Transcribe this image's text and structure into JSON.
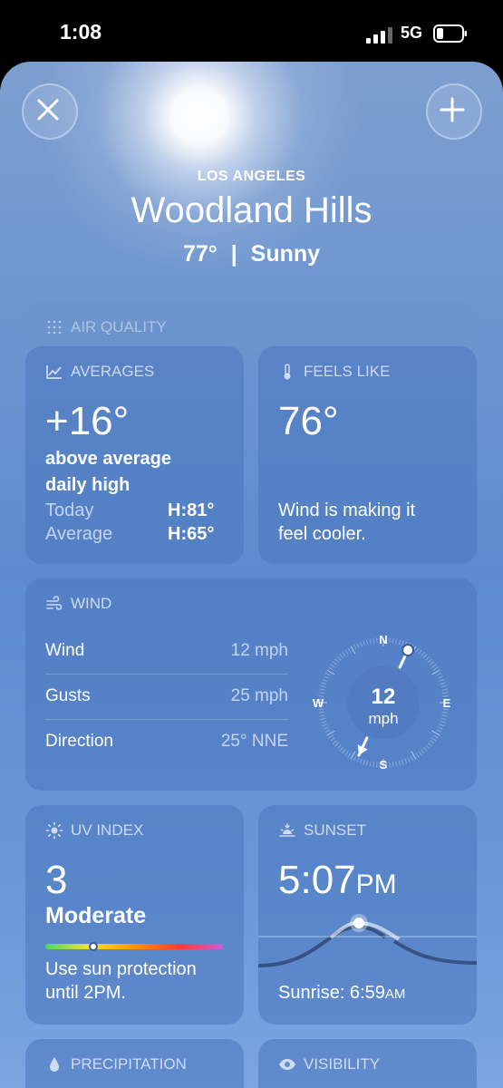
{
  "status": {
    "time": "1:08",
    "network": "5G"
  },
  "header": {
    "city": "LOS ANGELES",
    "place": "Woodland Hills",
    "temp": "77°",
    "separator": "|",
    "condition": "Sunny"
  },
  "icons": {
    "close": "close-icon",
    "add": "plus-icon"
  },
  "air_quality": {
    "title": "AIR QUALITY"
  },
  "averages": {
    "title": "AVERAGES",
    "value": "+16°",
    "line1": "above average",
    "line2": "daily high",
    "today_label": "Today",
    "today_value": "H:81°",
    "avg_label": "Average",
    "avg_value": "H:65°"
  },
  "feels_like": {
    "title": "FEELS LIKE",
    "value": "76°",
    "line1": "Wind is making it",
    "line2": "feel cooler."
  },
  "wind": {
    "title": "WIND",
    "rows": [
      {
        "label": "Wind",
        "value": "12 mph"
      },
      {
        "label": "Gusts",
        "value": "25 mph"
      },
      {
        "label": "Direction",
        "value": "25° NNE"
      }
    ],
    "compass": {
      "speed": "12",
      "unit": "mph",
      "n": "N",
      "e": "E",
      "s": "S",
      "w": "W",
      "direction_deg": 25
    }
  },
  "uv": {
    "title": "UV INDEX",
    "value": "3",
    "level": "Moderate",
    "level_fraction": 0.27,
    "line1": "Use sun protection",
    "line2": "until 2PM."
  },
  "sunset": {
    "title": "SUNSET",
    "time": "5:07",
    "ampm": "PM",
    "sunrise_label": "Sunrise: 6:59",
    "sunrise_ampm": "AM"
  },
  "precip": {
    "title": "PRECIPITATION"
  },
  "visibility": {
    "title": "VISIBILITY"
  }
}
